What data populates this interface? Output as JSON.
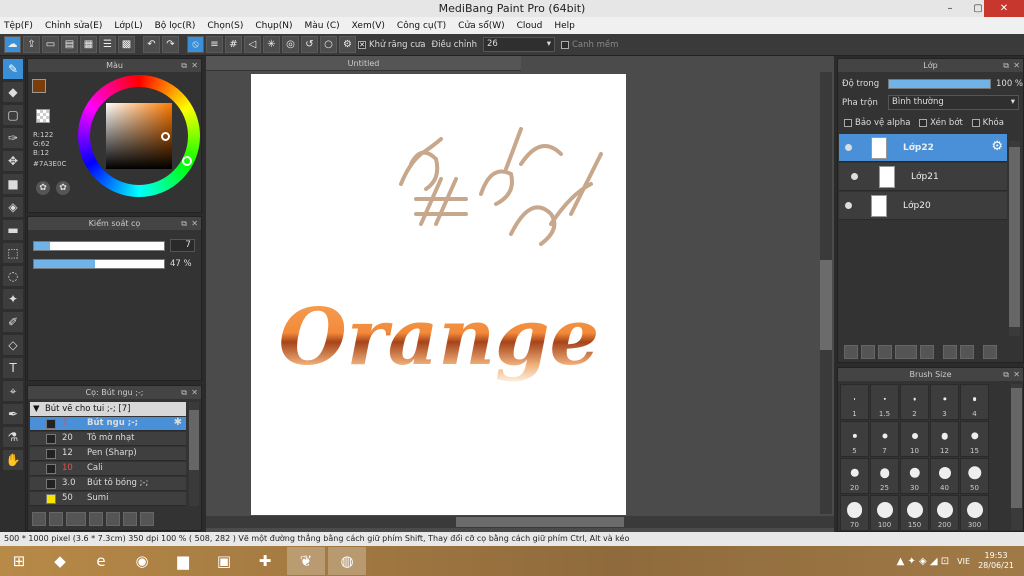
{
  "window": {
    "title": "MediBang Paint Pro (64bit)",
    "min": "–",
    "max": "▢",
    "close": "✕"
  },
  "menu": [
    "Tệp(F)",
    "Chỉnh sửa(E)",
    "Lớp(L)",
    "Bộ lọc(R)",
    "Chọn(S)",
    "Chụp(N)",
    "Màu (C)",
    "Xem(V)",
    "Công cụ(T)",
    "Cửa sổ(W)",
    "Cloud",
    "Help"
  ],
  "toolbar": {
    "antialias_label": "Khử răng cưa",
    "correction_label": "Điều chỉnh",
    "correction_value": "26",
    "snap_label": "Canh mềm"
  },
  "color_panel": {
    "title": "Màu",
    "r": "R:122",
    "g": "G:62",
    "b": "B:12",
    "hex": "#7A3E0C",
    "primary": "#7a3e0c"
  },
  "brush_control": {
    "title": "Kiểm soát cọ",
    "size_value": "7",
    "opacity_value": "47 %",
    "opacity_frac": 0.47
  },
  "brush_list": {
    "title": "Cọ: Bút ngu ;-;",
    "group": "Bút vẽ cho tui ;-; [7]",
    "items": [
      {
        "size": "7",
        "name": "Bút ngu ;-;",
        "sel": true
      },
      {
        "size": "20",
        "name": "Tô mờ nhạt"
      },
      {
        "size": "12",
        "name": "Pen (Sharp)"
      },
      {
        "size": "10",
        "name": "Cali"
      },
      {
        "size": "3.0",
        "name": "Bút tô bóng ;-;"
      },
      {
        "size": "50",
        "name": "Sumi"
      }
    ]
  },
  "document": {
    "tab": "Untitled",
    "artwork_text": "Orange"
  },
  "layer_panel": {
    "title": "Lớp",
    "opacity_label": "Độ trong",
    "opacity_value": "100 %",
    "blend_label": "Pha trộn",
    "blend_value": "Bình thường",
    "protect_alpha": "Bảo vệ alpha",
    "clipping": "Xén bớt",
    "lock": "Khóa",
    "layers": [
      "Lớp22",
      "Lớp21",
      "Lớp20"
    ]
  },
  "brush_size_panel": {
    "title": "Brush Size",
    "sizes": [
      "1",
      "1.5",
      "2",
      "3",
      "4",
      "5",
      "7",
      "10",
      "12",
      "15",
      "20",
      "25",
      "30",
      "40",
      "50",
      "70",
      "100",
      "150",
      "200",
      "300"
    ]
  },
  "status": "500 * 1000 pixel  (3.6 * 7.3cm)  350 dpi  100 %  ( 508, 282 )  Vẽ một đường thẳng bằng cách giữ phím Shift, Thay đổi cỡ cọ bằng cách giữ phím Ctrl, Alt và kéo",
  "taskbar": {
    "lang": "VIE",
    "time": "19:53",
    "date": "28/06/21"
  }
}
